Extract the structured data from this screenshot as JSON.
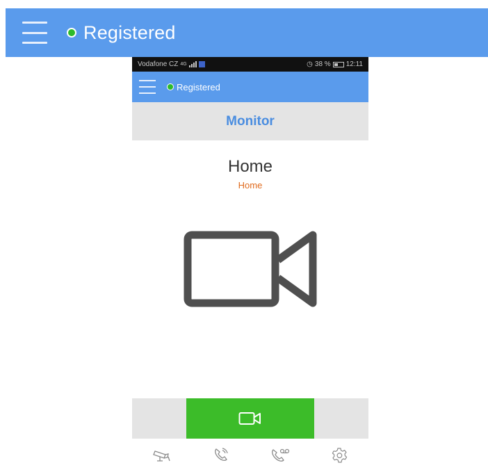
{
  "top_banner": {
    "status_text": "Registered"
  },
  "phone": {
    "status_bar": {
      "carrier": "Vodafone CZ",
      "network": "4G",
      "battery": "38 %",
      "time": "12:11"
    },
    "app_bar": {
      "status_text": "Registered"
    },
    "section": {
      "title": "Monitor"
    },
    "device": {
      "name": "Home",
      "subtitle": "Home"
    },
    "tabs": [
      {
        "icon": "cctv-camera-icon"
      },
      {
        "icon": "phone-ringing-icon"
      },
      {
        "icon": "phone-voicemail-icon"
      },
      {
        "icon": "gear-icon"
      }
    ]
  },
  "colors": {
    "app_bar": "#5a9bec",
    "registered_dot": "#2dbb2a",
    "section_title": "#4a8de0",
    "subtitle": "#e06a1c",
    "call_button": "#3cbc29",
    "gray_bar": "#e4e4e4"
  }
}
